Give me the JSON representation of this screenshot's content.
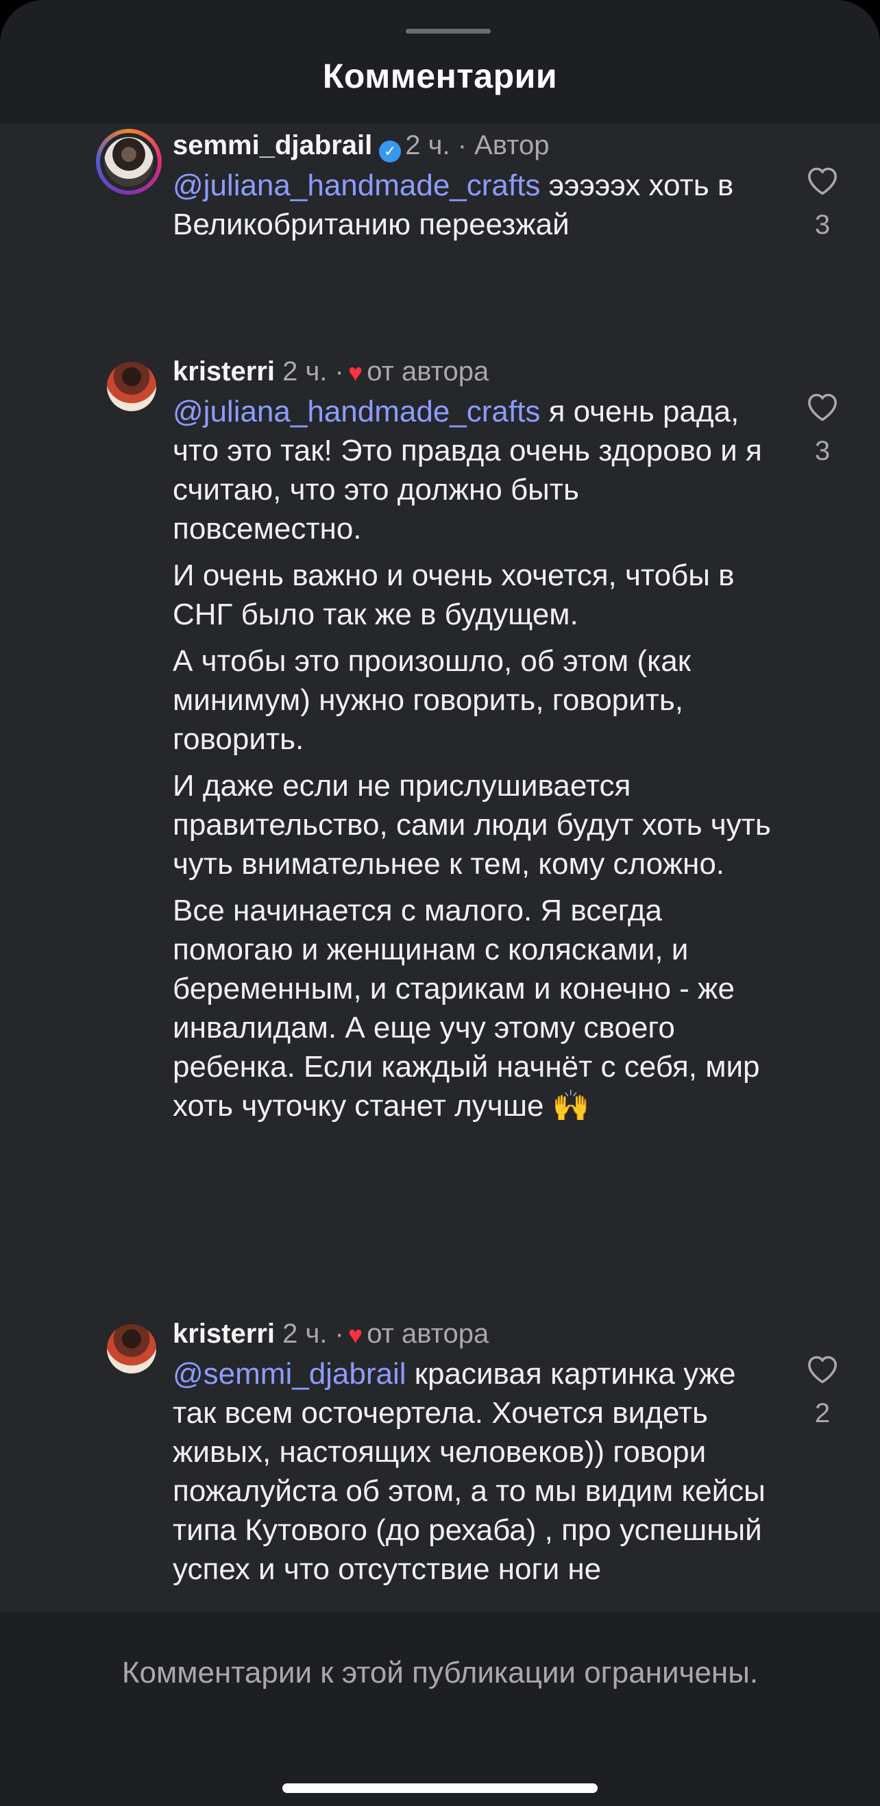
{
  "sheet": {
    "title": "Комментарии"
  },
  "comments": [
    {
      "username": "semmi_djabrail",
      "verified": true,
      "time": "2 ч.",
      "tag": "· Автор",
      "liked_by_author": false,
      "avatar_icon": "avatar-with-story-ring",
      "paragraphs": [
        {
          "mention": "@juliana_handmade_crafts",
          "text": " эээээх хоть в Великобританию переезжай"
        }
      ],
      "likes": "3"
    },
    {
      "username": "kristerri",
      "verified": false,
      "time": "2 ч. ·",
      "tag": "от автора",
      "liked_by_author": true,
      "paragraphs": [
        {
          "mention": "@juliana_handmade_crafts",
          "text": "  я очень рада, что это так! Это правда очень здорово и я считаю, что это должно быть повсеместно."
        },
        {
          "text": "И очень важно и очень хочется, чтобы в СНГ было так же в будущем."
        },
        {
          "text": "А чтобы это произошло, об этом (как минимум) нужно говорить, говорить, говорить."
        },
        {
          "text": "И даже если не прислушивается правительство, сами люди будут хоть чуть чуть внимательнее к тем, кому сложно."
        },
        {
          "text": "Все начинается с малого. Я всегда помогаю и женщинам с колясками, и беременным, и старикам и конечно - же инвалидам. А еще учу этому своего ребенка. Если каждый начнёт с себя, мир хоть чуточку станет лучше 🙌"
        }
      ],
      "likes": "3"
    },
    {
      "username": "kristerri",
      "verified": false,
      "time": "2 ч. ·",
      "tag": "от автора",
      "liked_by_author": true,
      "paragraphs": [
        {
          "mention": "@semmi_djabrail",
          "text": " красивая картинка уже так всем осточертела. Хочется видеть живых, настоящих человеков)) говори пожалуйста об этом, а то мы видим кейсы типа Кутового (до рехаба) , про успешный успех и что отсутствие ноги не"
        }
      ],
      "likes": "2"
    }
  ],
  "footer": {
    "text": "Комментарии к этой публикации ограничены."
  },
  "colors": {
    "mention": "#8d9cff",
    "heart": "#ff3040",
    "verified": "#3897f0"
  }
}
